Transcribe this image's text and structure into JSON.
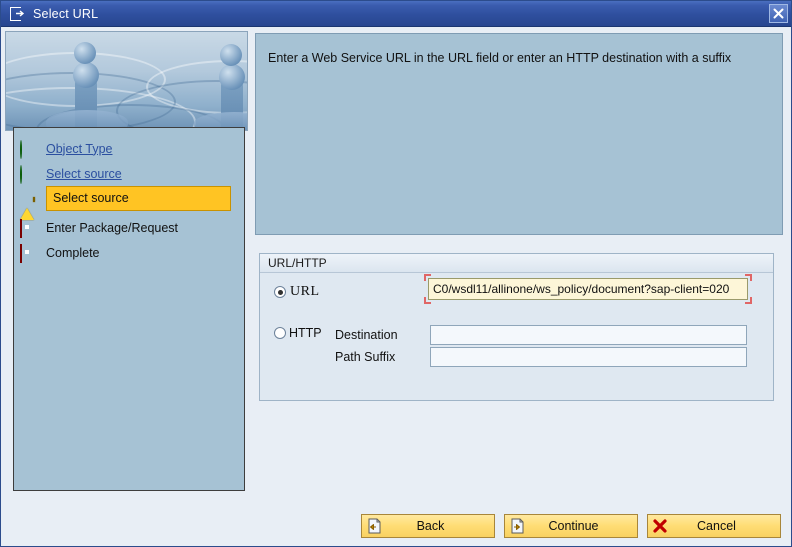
{
  "window": {
    "title": "Select URL",
    "title_icon": "document-arrow-icon",
    "close_icon": "close-icon",
    "close_label": "X"
  },
  "left_panel": {
    "splash_image_name": "water-droplet-splash-image",
    "steps": [
      {
        "label": "Object Type",
        "status": "done",
        "icon": "green-circle-icon"
      },
      {
        "label": "Select source",
        "status": "done",
        "icon": "green-circle-icon"
      },
      {
        "label": "Select source",
        "status": "current",
        "icon": "warning-triangle-icon"
      },
      {
        "label": "Enter Package/Request",
        "status": "pending",
        "icon": "red-square-icon"
      },
      {
        "label": "Complete",
        "status": "pending",
        "icon": "red-square-icon"
      }
    ]
  },
  "instruction": {
    "text": "Enter a Web Service URL in the URL field or enter an HTTP destination with a suffix"
  },
  "group": {
    "title": "URL/HTTP",
    "url_option": {
      "label": "URL",
      "selected": true,
      "value": "C0/wsdl11/allinone/ws_policy/document?sap-client=020",
      "placeholder": ""
    },
    "http_option": {
      "label": "HTTP",
      "selected": false,
      "destination_label": "Destination",
      "destination_value": "",
      "destination_placeholder": "",
      "path_suffix_label": "Path Suffix",
      "path_suffix_value": "",
      "path_suffix_placeholder": ""
    }
  },
  "footer": {
    "back_label": "Back",
    "back_icon": "back-document-icon",
    "continue_label": "Continue",
    "continue_icon": "continue-document-icon",
    "cancel_label": "Cancel",
    "cancel_icon": "red-x-icon"
  },
  "colors": {
    "titlebar": "#2f4f9e",
    "panel_blue": "#a6c2d4",
    "dialog_bg": "#e8eef5",
    "highlight": "#ffc423",
    "button_yellow": "#ffdd74",
    "input_focus": "#fdf6d8",
    "link": "#2b4fa0",
    "error_red": "#c00000",
    "ok_green": "#2bbd15"
  }
}
